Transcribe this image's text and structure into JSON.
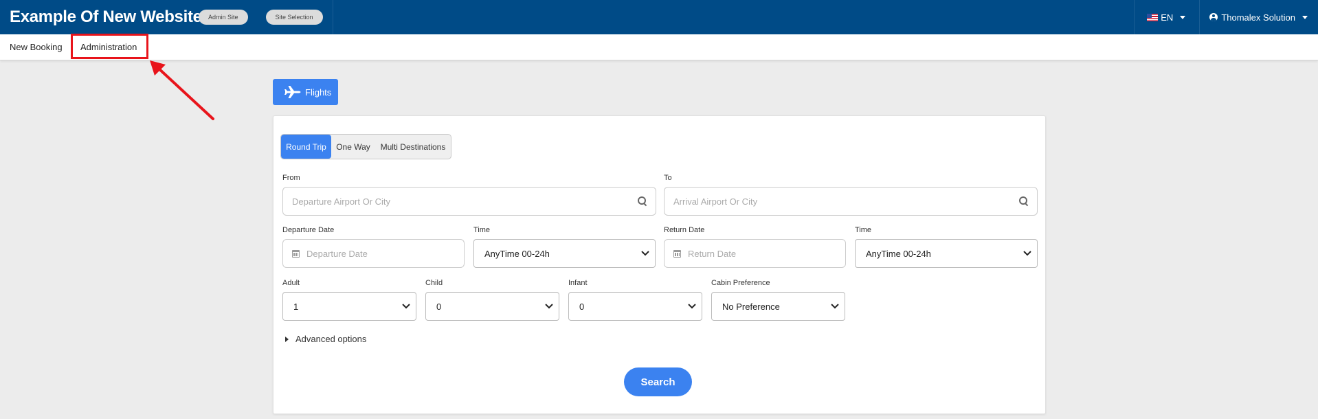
{
  "header": {
    "title": "Example Of New Website",
    "admin_site": "Admin Site",
    "site_selection": "Site Selection",
    "language": "EN",
    "user": "Thomalex Solution"
  },
  "nav": {
    "new_booking": "New Booking",
    "administration": "Administration"
  },
  "product_tab": "Flights",
  "trip_types": [
    "Round Trip",
    "One Way",
    "Multi Destinations"
  ],
  "form": {
    "from_label": "From",
    "from_placeholder": "Departure Airport Or City",
    "to_label": "To",
    "to_placeholder": "Arrival Airport Or City",
    "departure_date_label": "Departure Date",
    "departure_date_placeholder": "Departure Date",
    "departure_time_label": "Time",
    "departure_time_value": "AnyTime 00-24h",
    "return_date_label": "Return Date",
    "return_date_placeholder": "Return Date",
    "return_time_label": "Time",
    "return_time_value": "AnyTime 00-24h",
    "adult_label": "Adult",
    "adult_value": "1",
    "child_label": "Child",
    "child_value": "0",
    "infant_label": "Infant",
    "infant_value": "0",
    "cabin_label": "Cabin Preference",
    "cabin_value": "No Preference",
    "advanced_options": "Advanced options",
    "search": "Search"
  },
  "annotation": {
    "color": "#e8141b"
  }
}
